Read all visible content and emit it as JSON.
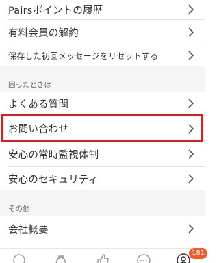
{
  "menu": {
    "items": [
      {
        "label": "Pairsポイントの履歴"
      },
      {
        "label": "有料会員の解約"
      },
      {
        "label": "保存した初回メッセージをリセットする"
      }
    ]
  },
  "help": {
    "section_title": "困ったときは",
    "items": [
      {
        "label": "よくある質問"
      },
      {
        "label": "お問い合わせ"
      },
      {
        "label": "安心の常時監視体制"
      },
      {
        "label": "安心のセキュリティ"
      }
    ]
  },
  "other": {
    "section_title": "その他",
    "items": [
      {
        "label": "会社概要"
      }
    ]
  },
  "tabbar": {
    "tabs": [
      {
        "icon": "search-icon"
      },
      {
        "icon": "community-icon"
      },
      {
        "icon": "like-icon"
      },
      {
        "icon": "message-icon"
      },
      {
        "icon": "profile-icon"
      }
    ],
    "profile_badge": "181"
  },
  "colors": {
    "highlight_border": "#e21a1a",
    "badge_background": "#f05a28",
    "section_background": "#f5f5f5"
  }
}
